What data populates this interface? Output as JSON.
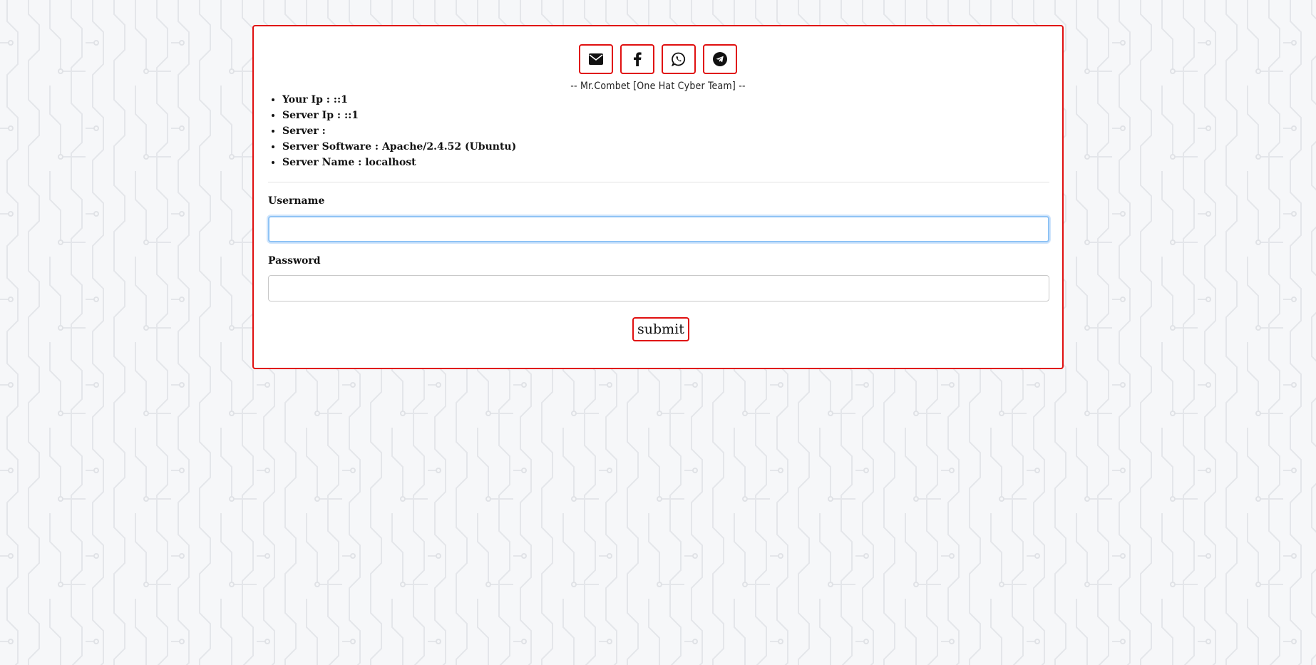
{
  "theme": {
    "accent": "#e01010",
    "focus_ring": "#8fc3f5",
    "background": "#f6f7f9"
  },
  "social": [
    {
      "name": "email",
      "icon": "envelope-icon"
    },
    {
      "name": "facebook",
      "icon": "facebook-icon"
    },
    {
      "name": "whatsapp",
      "icon": "whatsapp-icon"
    },
    {
      "name": "telegram",
      "icon": "telegram-icon"
    }
  ],
  "credit": "-- Mr.Combet [One Hat Cyber Team] --",
  "server_info": [
    "Your Ip : ::1",
    "Server Ip : ::1",
    "Server :",
    "Server Software : Apache/2.4.52 (Ubuntu)",
    "Server Name : localhost"
  ],
  "form": {
    "username_label": "Username",
    "username_value": "",
    "password_label": "Password",
    "password_value": "",
    "submit_label": "submit"
  }
}
